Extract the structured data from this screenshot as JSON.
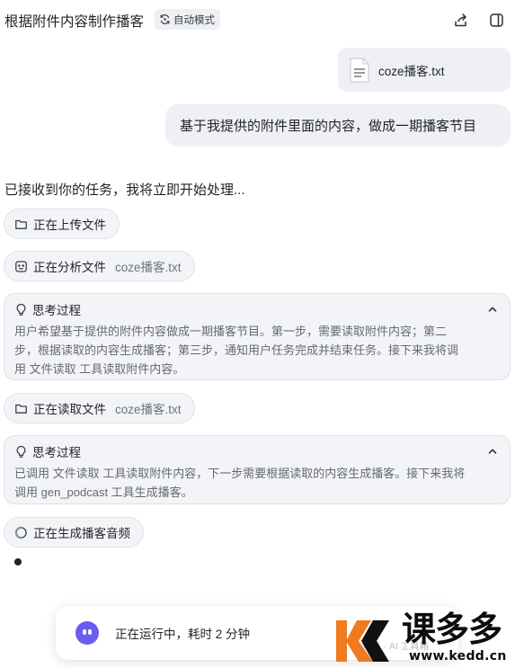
{
  "header": {
    "title": "根据附件内容制作播客",
    "mode_label": "自动模式",
    "share_icon": "share-icon",
    "panel_icon": "sidebar-panel-icon"
  },
  "attachment": {
    "file_name": "coze播客.txt",
    "icon": "text-file-icon"
  },
  "user_message": "基于我提供的附件里面的内容，做成一期播客节目",
  "assistant": {
    "intro": "已接收到你的任务，我将立即开始处理...",
    "steps": [
      {
        "label": "正在上传文件",
        "file": ""
      },
      {
        "label": "正在分析文件",
        "file": "coze播客.txt"
      },
      {
        "label": "正在读取文件",
        "file": "coze播客.txt"
      },
      {
        "label": "正在生成播客音频",
        "file": ""
      }
    ],
    "thoughts": [
      {
        "title": "思考过程",
        "lines": [
          "用户希望基于提供的附件内容做成一期播客节目。第一步，需要读取附件内容；第二",
          "步，根据读取的内容生成播客；第三步，通知用户任务完成并结束任务。接下来我将调",
          "用 文件读取 工具读取附件内容。"
        ]
      },
      {
        "title": "思考过程",
        "lines": [
          "已调用 文件读取 工具读取附件内容，下一步需要根据读取的内容生成播客。接下来我将",
          "调用 gen_podcast 工具生成播客。"
        ]
      }
    ]
  },
  "status_bar": {
    "text": "正在运行中，耗时 2 分钟"
  },
  "watermark": {
    "faint": "公众号 · AI 工具箱",
    "brand": "课多多",
    "domain": "www.kedd.cn"
  },
  "colors": {
    "accent": "#6a5cf2",
    "card_bg": "#f3f4f7",
    "bubble_bg": "#eef0f5",
    "muted_text": "#656a73",
    "logo_orange": "#f07a1e"
  }
}
